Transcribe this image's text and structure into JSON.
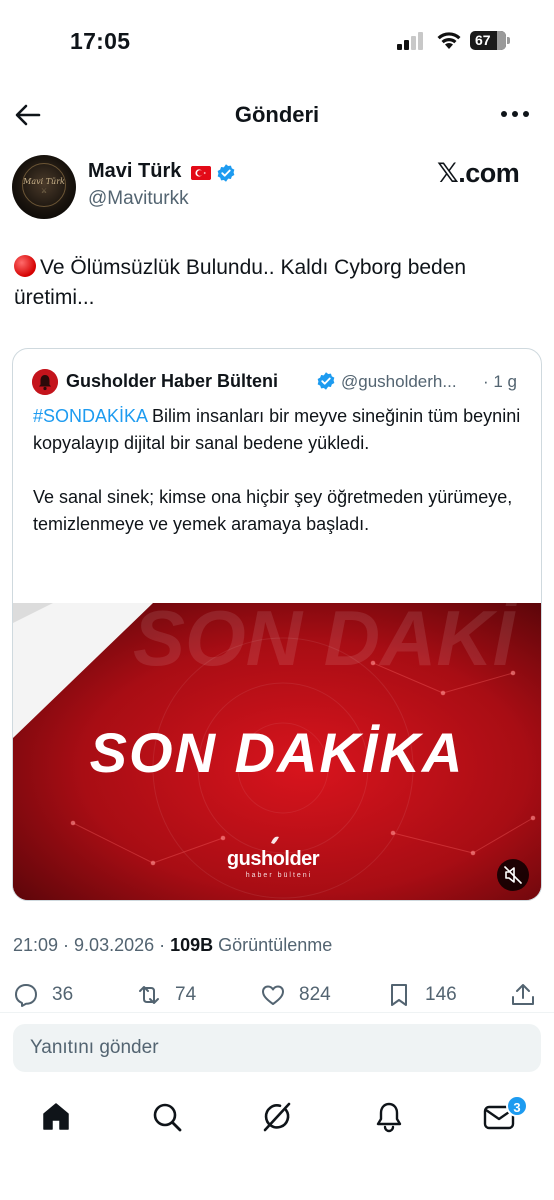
{
  "status_bar": {
    "time": "17:05",
    "battery": "67"
  },
  "header": {
    "title": "Gönderi"
  },
  "author": {
    "name": "Mavi Türk",
    "handle": "@Maviturkk",
    "avatar_text": "Mavi Türk"
  },
  "watermark": "𝕏.com",
  "tweet": {
    "text": "Ve Ölümsüzlük Bulundu.. Kaldı Cyborg beden üretimi..."
  },
  "quote": {
    "name": "Gusholder Haber Bülteni",
    "handle": "@gusholderh...",
    "time": "· 1 g",
    "hashtag": "#SONDAKİKA",
    "text_1": " Bilim insanları bir meyve sineğinin tüm beynini kopyalayıp dijital bir sanal bedene yükledi.",
    "text_2": "Ve sanal sinek; kimse ona hiçbir şey öğretmeden yürümeye, temizlenmeye ve yemek aramaya başladı.",
    "media": {
      "headline": "SON DAKİKA",
      "bg_text": "SON DAKİ",
      "brand": "gusholder",
      "brand_sub": "haber bülteni"
    }
  },
  "meta": {
    "timestamp": "21:09 · 9.03.2026 · ",
    "views": "109B",
    "views_label": " Görüntülenme"
  },
  "actions": {
    "replies": "36",
    "reposts": "74",
    "likes": "824",
    "bookmarks": "146"
  },
  "reply": {
    "placeholder": "Yanıtını gönder"
  },
  "nav": {
    "messages_badge": "3"
  },
  "colors": {
    "accent": "#1d9bf0",
    "text": "#0f1419",
    "muted": "#536471",
    "media_red": "#b5121b"
  }
}
